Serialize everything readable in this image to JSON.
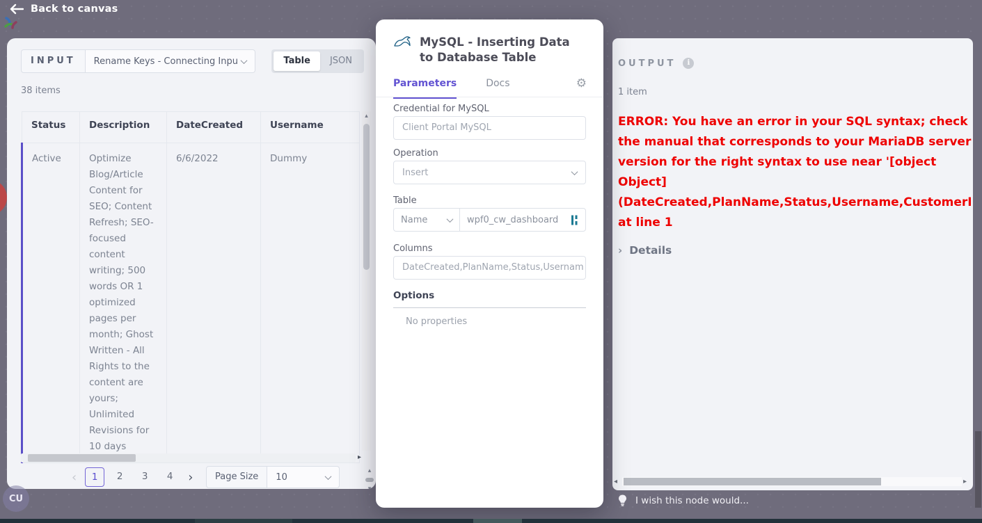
{
  "topbar": {
    "back_label": "Back to canvas"
  },
  "input_panel": {
    "label": "INPUT",
    "source_dropdown_value": "Rename Keys - Connecting Inpu",
    "view_toggle": {
      "table_label": "Table",
      "json_label": "JSON"
    },
    "items_count": "38 items",
    "table": {
      "headers": [
        "Status",
        "Description",
        "DateCreated",
        "Username"
      ],
      "row": {
        "status": "Active",
        "description": "Optimize Blog/Article Content for SEO; Content Refresh; SEO-focused content writing; 500 words OR 1 optimized pages per month; Ghost Written - All Rights to the content are yours; Unlimited Revisions for 10 days",
        "date_created": "6/6/2022",
        "username": "Dummy"
      }
    },
    "pagination": {
      "pages": [
        "1",
        "2",
        "3",
        "4"
      ],
      "current_page": "1",
      "page_size_label": "Page Size",
      "page_size_value": "10"
    }
  },
  "node_modal": {
    "title": "MySQL - Inserting Data to Database Table",
    "tabs": {
      "parameters": "Parameters",
      "docs": "Docs"
    },
    "credential_label": "Credential for MySQL",
    "credential_value": "Client Portal MySQL",
    "operation_label": "Operation",
    "operation_value": "Insert",
    "table_label": "Table",
    "table_mode_value": "Name",
    "table_value": "wpf0_cw_dashboard",
    "columns_label": "Columns",
    "columns_value": "DateCreated,PlanName,Status,Usernam",
    "options_label": "Options",
    "options_empty": "No properties"
  },
  "output_panel": {
    "label": "OUTPUT",
    "items_count": "1 item",
    "error_message": "ERROR: You have an error in your SQL syntax; check the manual that corresponds to your MariaDB server version for the right syntax to use near '[object Object] (DateCreated,PlanName,Status,Username,CustomerI at line 1",
    "details_label": "Details"
  },
  "footer": {
    "wish_label": "I wish this node would..."
  },
  "avatar": {
    "initials": "CU"
  },
  "icons": {
    "info": "i",
    "gear": "⚙",
    "page_prev": "‹",
    "page_next": "›",
    "scroll_up": "▴",
    "scroll_down": "▾",
    "scroll_left": "◂",
    "scroll_right": "▸",
    "details_chevron": "›"
  },
  "colors": {
    "accent_purple": "#6253d2",
    "error_red": "#ee0000",
    "expression_teal": "#1c7a93",
    "canvas": "#6f6c7c",
    "panel_bg": "#f2f3f7"
  }
}
